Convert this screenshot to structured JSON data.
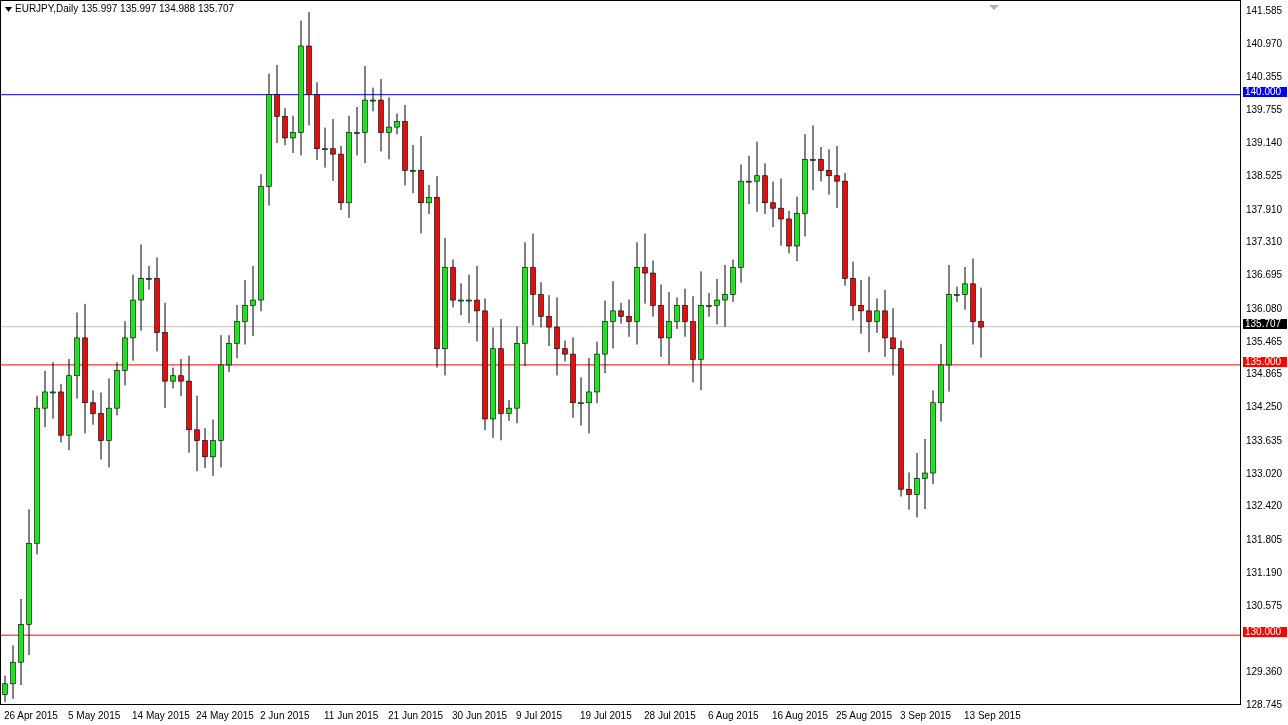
{
  "chart_header": {
    "symbol": "EURJPY,Daily",
    "ohlc": "135.997 135.997 134.988 135.707"
  },
  "price_axis": [
    "141.585",
    "140.970",
    "140.355",
    "139.755",
    "139.140",
    "138.525",
    "137.910",
    "137.310",
    "136.695",
    "136.080",
    "135.465",
    "134.865",
    "134.250",
    "133.635",
    "133.020",
    "132.420",
    "131.805",
    "131.190",
    "130.575",
    "129.360",
    "128.745"
  ],
  "levels": [
    {
      "price": "140.000",
      "color": "#0000ff",
      "kind": "line"
    },
    {
      "price": "135.707",
      "color": "#000000",
      "kind": "price"
    },
    {
      "price": "135.000",
      "color": "#ff0000",
      "kind": "line"
    },
    {
      "price": "130.000",
      "color": "#ff0000",
      "kind": "line"
    }
  ],
  "date_axis": [
    "26 Apr 2015",
    "5 May 2015",
    "14 May 2015",
    "24 May 2015",
    "2 Jun 2015",
    "11 Jun 2015",
    "21 Jun 2015",
    "30 Jun 2015",
    "9 Jul 2015",
    "19 Jul 2015",
    "28 Jul 2015",
    "6 Aug 2015",
    "16 Aug 2015",
    "25 Aug 2015",
    "3 Sep 2015",
    "13 Sep 2015"
  ]
}
